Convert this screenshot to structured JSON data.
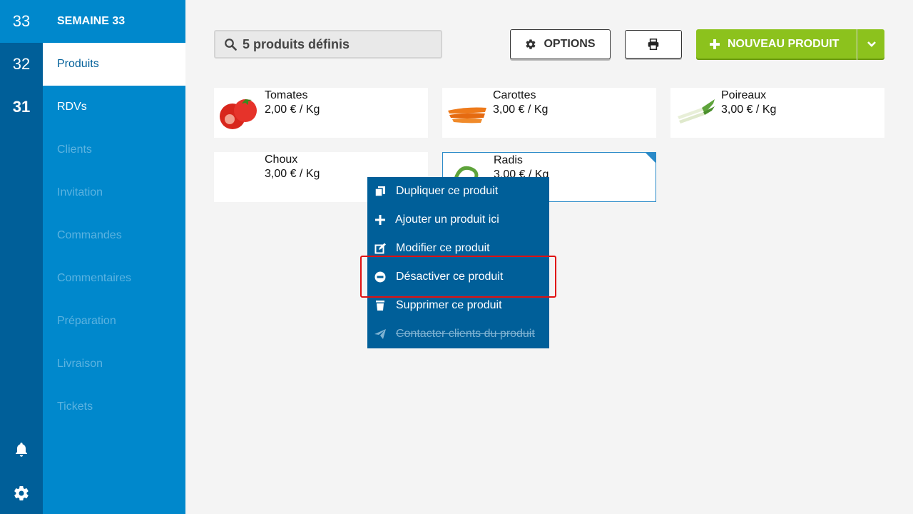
{
  "weeks": [
    {
      "label": "33"
    },
    {
      "label": "32"
    },
    {
      "label": "31"
    }
  ],
  "rail_icons": [
    "bell-icon",
    "gear-icon"
  ],
  "nav": {
    "title": "SEMAINE 33",
    "items": [
      {
        "label": "Produits",
        "state": "selected"
      },
      {
        "label": "RDVs",
        "state": "active"
      },
      {
        "label": "Clients",
        "state": "disabled"
      },
      {
        "label": "Invitation",
        "state": "disabled"
      },
      {
        "label": "Commandes",
        "state": "disabled"
      },
      {
        "label": "Commentaires",
        "state": "disabled"
      },
      {
        "label": "Préparation",
        "state": "disabled"
      },
      {
        "label": "Livraison",
        "state": "disabled"
      },
      {
        "label": "Tickets",
        "state": "disabled"
      }
    ]
  },
  "search": {
    "text": "5 produits définis",
    "icon": "search-icon"
  },
  "toolbar": {
    "options_label": "OPTIONS",
    "print_icon": "print-icon",
    "new_label": "NOUVEAU PRODUIT",
    "new_icon": "plus-icon",
    "dropdown_icon": "chevron-down-icon"
  },
  "products": [
    {
      "name": "Tomates",
      "price": "2,00 € / Kg",
      "image": "tomato"
    },
    {
      "name": "Carottes",
      "price": "3,00 € / Kg",
      "image": "carrot"
    },
    {
      "name": "Poireaux",
      "price": "3,00 € / Kg",
      "image": "leek"
    },
    {
      "name": "Choux",
      "price": "3,00 € / Kg",
      "image": "none"
    },
    {
      "name": "Radis",
      "price": "3,00 € / Kg",
      "image": "radish",
      "selected": true
    }
  ],
  "context_menu": {
    "items": [
      {
        "label": "Dupliquer ce produit",
        "icon": "copy-icon",
        "enabled": true
      },
      {
        "label": "Ajouter un produit ici",
        "icon": "plus-icon",
        "enabled": true
      },
      {
        "label": "Modifier ce produit",
        "icon": "edit-icon",
        "enabled": true
      },
      {
        "label": "Désactiver ce produit",
        "icon": "minus-circle-icon",
        "enabled": true,
        "highlighted": true
      },
      {
        "label": "Supprimer ce produit",
        "icon": "trash-icon",
        "enabled": true
      },
      {
        "label": "Contacter clients du produit",
        "icon": "send-icon",
        "enabled": false
      }
    ]
  },
  "colors": {
    "rail": "#005f99",
    "nav": "#0088cc",
    "accent_green": "#8cc21d",
    "menu": "#005f99",
    "highlight": "#e01010"
  }
}
